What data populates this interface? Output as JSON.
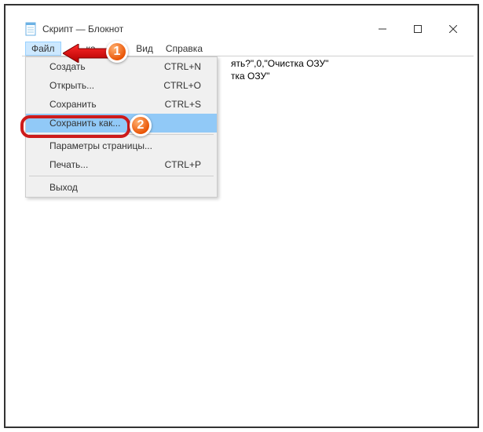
{
  "window": {
    "title": "Скрипт — Блокнот"
  },
  "menubar": {
    "file": "Файл",
    "edit": "ка",
    "format": "т",
    "view": "Вид",
    "help": "Справка"
  },
  "dropdown": {
    "create": {
      "label": "Создать",
      "shortcut": "CTRL+N"
    },
    "open": {
      "label": "Открыть...",
      "shortcut": "CTRL+O"
    },
    "save": {
      "label": "Сохранить",
      "shortcut": "CTRL+S"
    },
    "save_as": {
      "label": "Сохранить как...",
      "shortcut": ""
    },
    "page_setup": {
      "label": "Параметры страницы...",
      "shortcut": ""
    },
    "print": {
      "label": "Печать...",
      "shortcut": "CTRL+P"
    },
    "exit": {
      "label": "Выход",
      "shortcut": ""
    }
  },
  "content": {
    "line1_visible": "ять?\",0,\"Очистка ОЗУ\"",
    "line2_visible": "",
    "line3_visible": "тка ОЗУ\""
  },
  "markers": {
    "one": "1",
    "two": "2"
  }
}
